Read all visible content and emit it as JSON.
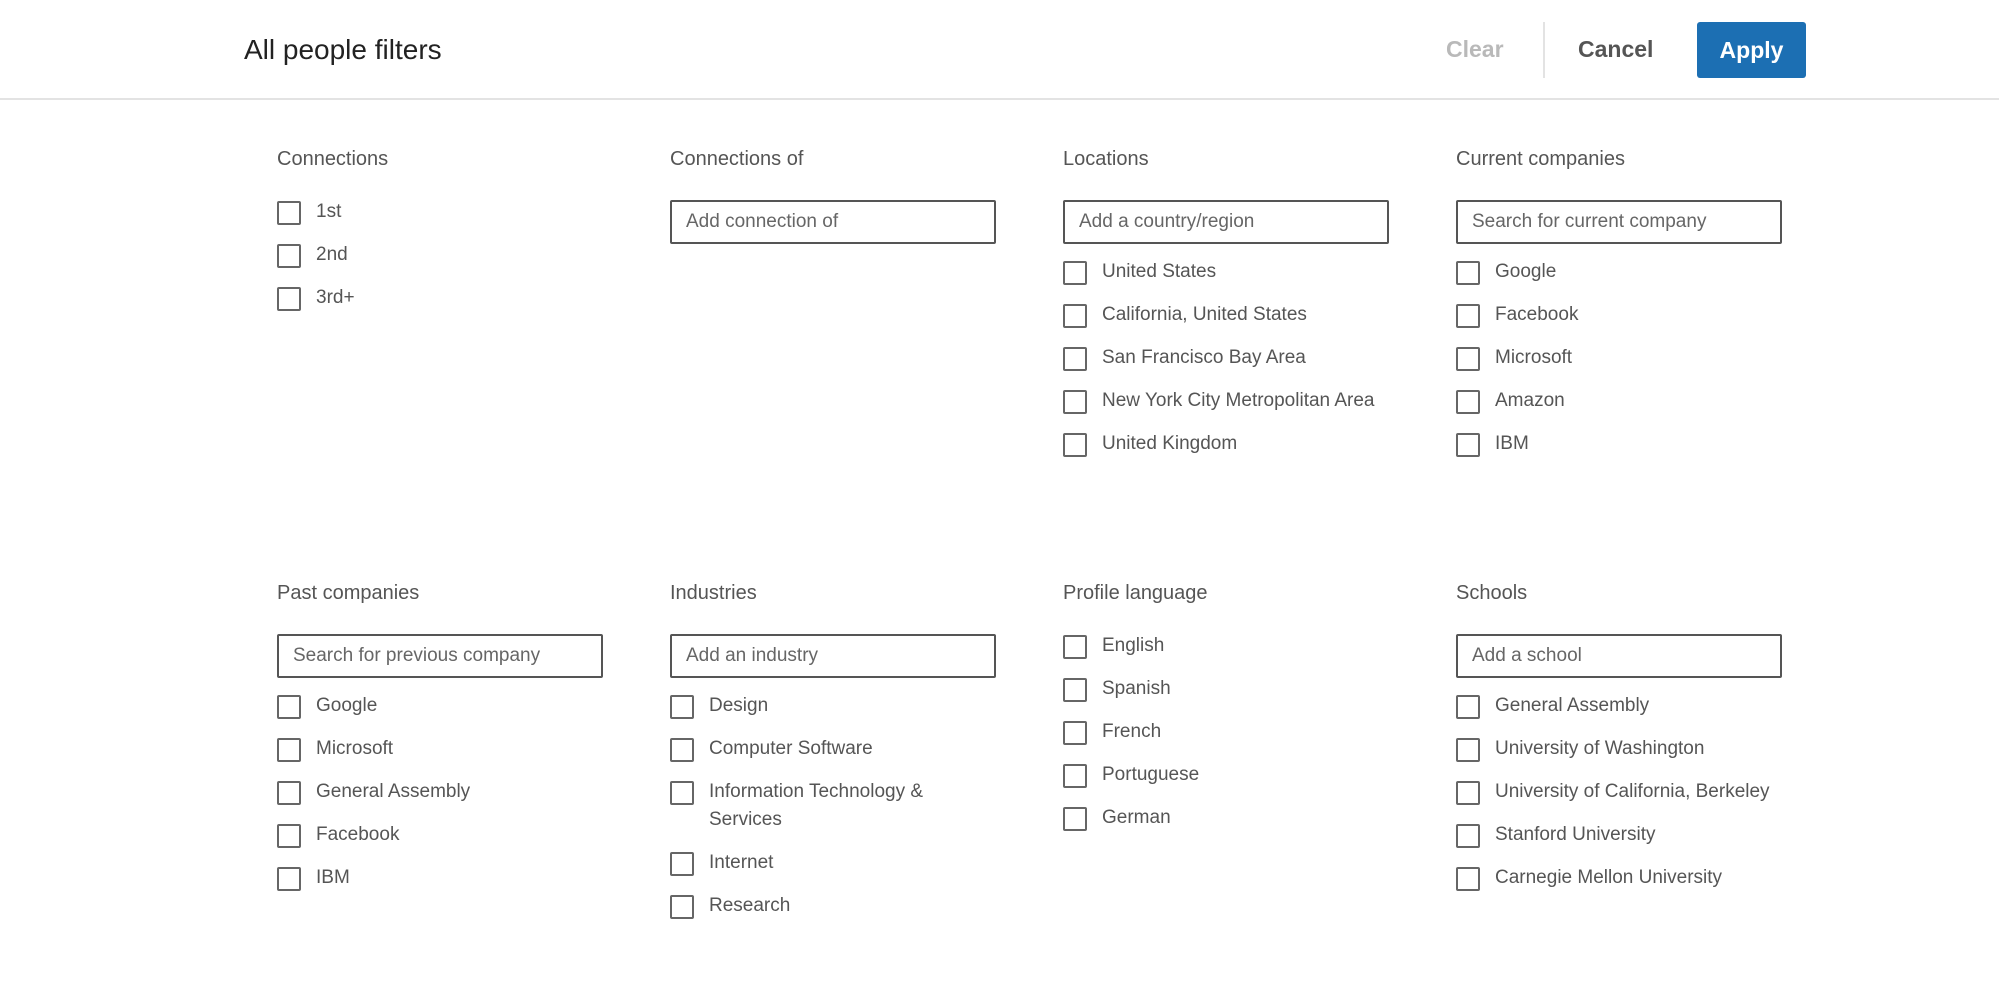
{
  "header": {
    "title": "All people filters",
    "clear_label": "Clear",
    "cancel_label": "Cancel",
    "apply_label": "Apply"
  },
  "colors": {
    "accent": "#1c6fb3",
    "disabled_text": "#b9b9b9",
    "border": "#555555"
  },
  "sections": {
    "connections": {
      "title": "Connections",
      "options": [
        "1st",
        "2nd",
        "3rd+"
      ]
    },
    "connections_of": {
      "title": "Connections of",
      "placeholder": "Add connection of"
    },
    "locations": {
      "title": "Locations",
      "placeholder": "Add a country/region",
      "options": [
        "United States",
        "California, United States",
        "San Francisco Bay Area",
        "New York City Metropolitan Area",
        "United Kingdom"
      ]
    },
    "current_companies": {
      "title": "Current companies",
      "placeholder": "Search for current company",
      "options": [
        "Google",
        "Facebook",
        "Microsoft",
        "Amazon",
        "IBM"
      ]
    },
    "past_companies": {
      "title": "Past companies",
      "placeholder": "Search for previous company",
      "options": [
        "Google",
        "Microsoft",
        "General Assembly",
        "Facebook",
        "IBM"
      ]
    },
    "industries": {
      "title": "Industries",
      "placeholder": "Add an industry",
      "options": [
        "Design",
        "Computer Software",
        "Information Technology & Services",
        "Internet",
        "Research"
      ]
    },
    "profile_language": {
      "title": "Profile language",
      "options": [
        "English",
        "Spanish",
        "French",
        "Portuguese",
        "German"
      ]
    },
    "schools": {
      "title": "Schools",
      "placeholder": "Add a school",
      "options": [
        "General Assembly",
        "University of Washington",
        "University of California, Berkeley",
        "Stanford University",
        "Carnegie Mellon University"
      ]
    }
  }
}
